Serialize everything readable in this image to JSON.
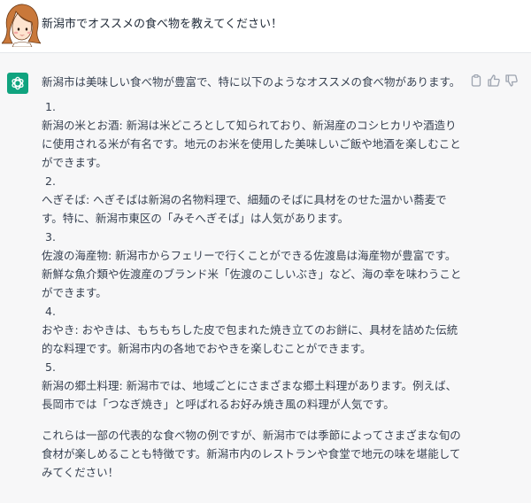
{
  "user": {
    "avatar_icon": "user-illustration-avatar",
    "message": "新潟市でオススメの食べ物を教えてください！"
  },
  "assistant": {
    "avatar_icon": "openai-logo-icon",
    "actions": {
      "copy_icon": "clipboard-icon",
      "like_icon": "thumbs-up-icon",
      "dislike_icon": "thumbs-down-icon"
    },
    "intro": "新潟市は美味しい食べ物が豊富で、特に以下のようなオススメの食べ物があります。",
    "items": [
      {
        "number": "1.",
        "text": "新潟の米とお酒: 新潟は米どころとして知られており、新潟産のコシヒカリや酒造りに使用される米が有名です。地元のお米を使用した美味しいご飯や地酒を楽しむことができます。"
      },
      {
        "number": "2.",
        "text": "へぎそば: へぎそばは新潟の名物料理で、細麺のそばに具材をのせた温かい蕎麦です。特に、新潟市東区の「みそへぎそば」は人気があります。"
      },
      {
        "number": "3.",
        "text": "佐渡の海産物: 新潟市からフェリーで行くことができる佐渡島は海産物が豊富です。新鮮な魚介類や佐渡産のブランド米「佐渡のこしいぶき」など、海の幸を味わうことができます。"
      },
      {
        "number": "4.",
        "text": "おやき: おやきは、もちもちした皮で包まれた焼き立てのお餅に、具材を詰めた伝統的な料理です。新潟市内の各地でおやきを楽しむことができます。"
      },
      {
        "number": "5.",
        "text": "新潟の郷土料理: 新潟市では、地域ごとにさまざまな郷土料理があります。例えば、長岡市では「つなぎ焼き」と呼ばれるお好み焼き風の料理が人気です。"
      }
    ],
    "outro": "これらは一部の代表的な食べ物の例ですが、新潟市では季節によってさまざまな旬の食材が楽しめることも特徴です。新潟市内のレストランや食堂で地元の味を堪能してみてください！"
  },
  "colors": {
    "assistant_bg": "#f7f7f8",
    "bot_accent": "#10a37f",
    "text": "#374151"
  }
}
